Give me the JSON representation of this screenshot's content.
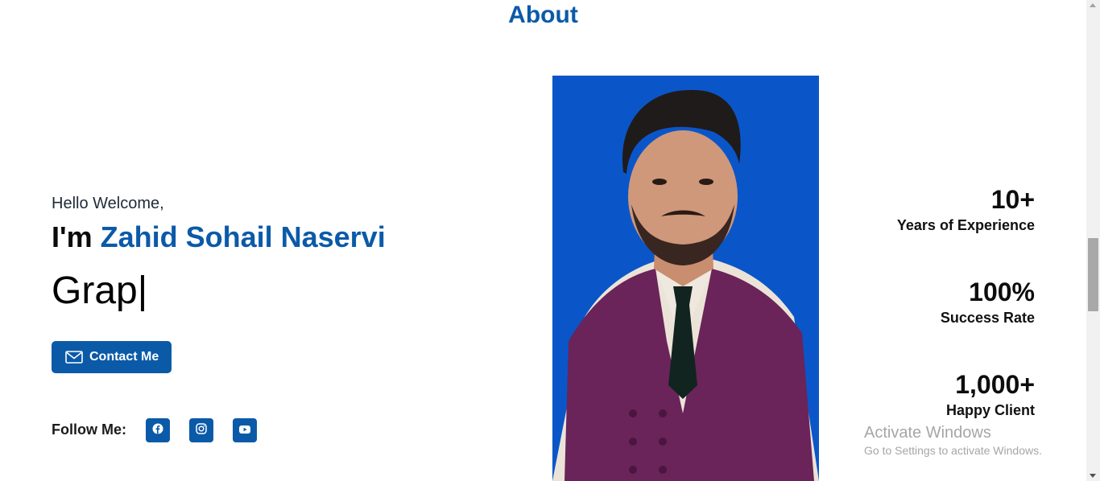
{
  "section": {
    "title": "About"
  },
  "intro": {
    "greeting": "Hello Welcome,",
    "im_prefix": "I'm ",
    "name": "Zahid Sohail Naservi",
    "typed_text": "Grap",
    "caret": "|"
  },
  "contact": {
    "label": "Contact Me",
    "icon": "envelope-icon"
  },
  "follow": {
    "label": "Follow Me:",
    "links": [
      {
        "icon": "facebook-icon"
      },
      {
        "icon": "instagram-icon"
      },
      {
        "icon": "youtube-icon"
      }
    ]
  },
  "stats": [
    {
      "value": "10+",
      "label": "Years of Experience"
    },
    {
      "value": "100%",
      "label": "Success Rate"
    },
    {
      "value": "1,000+",
      "label": "Happy Client"
    }
  ],
  "watermark": {
    "title": "Activate Windows",
    "subtitle": "Go to Settings to activate Windows."
  },
  "colors": {
    "accent": "#0b5aa8",
    "portrait_bg": "#0a56c9"
  }
}
